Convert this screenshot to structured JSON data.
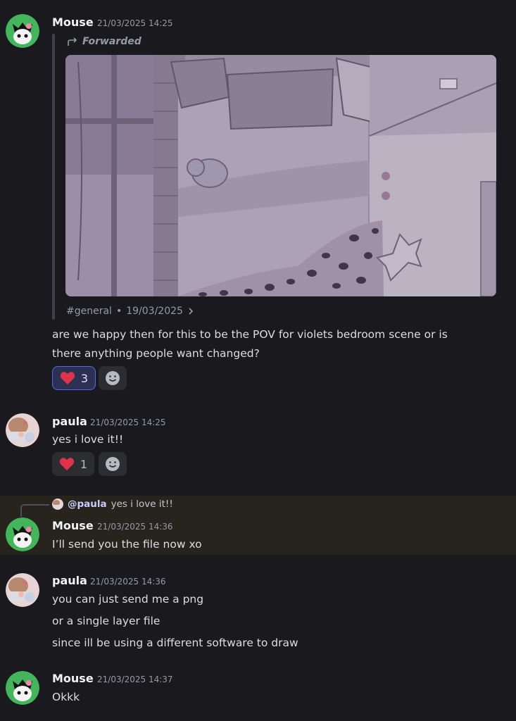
{
  "messages": [
    {
      "author": "Mouse",
      "timestamp": "21/03/2025 14:25",
      "forwarded_label": "Forwarded",
      "forward_source": "#general",
      "forward_date": "19/03/2025",
      "lines": [
        "are we happy then for this to be the POV for violets bedroom scene or is",
        "there anything people want changed?"
      ],
      "reaction_count": "3"
    },
    {
      "author": "paula",
      "timestamp": "21/03/2025 14:25",
      "lines": [
        "yes i love it!!"
      ],
      "reaction_count": "1"
    },
    {
      "author": "Mouse",
      "timestamp": "21/03/2025 14:36",
      "reply_mention": "@paula",
      "reply_text": "yes i love it!!",
      "lines": [
        "I’ll send you the file now xo"
      ]
    },
    {
      "author": "paula",
      "timestamp": "21/03/2025 14:36",
      "lines": [
        "you can just send me a png",
        "or a single layer file",
        "since ill be using a different software to draw"
      ]
    },
    {
      "author": "Mouse",
      "timestamp": "21/03/2025 14:37",
      "lines": [
        "Okkk"
      ]
    }
  ],
  "icons": {
    "forward": "forward-arrow-icon",
    "reaction": "heart-emoji",
    "add_reaction": "smiley-add-reaction-icon",
    "source_chevron": "chevron-right-icon"
  },
  "colors": {
    "background": "#1a1a1e",
    "highlight": "#27241d",
    "accent": "#5865f2",
    "heart": "#e0334b",
    "mouse_avatar_ring": "#3ba55d"
  }
}
